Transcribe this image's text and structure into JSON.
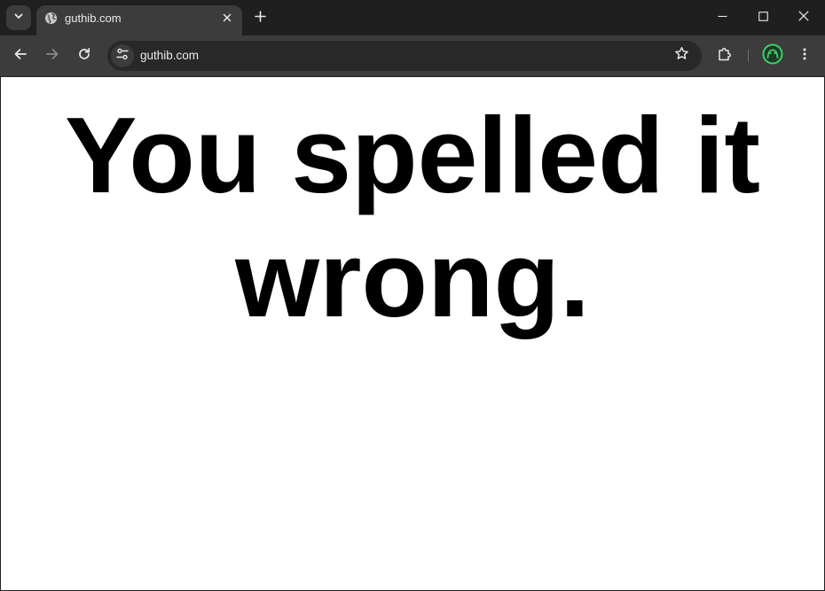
{
  "browser": {
    "tab": {
      "title": "guthib.com",
      "favicon": "globe-icon"
    },
    "address_bar": {
      "url": "guthib.com"
    },
    "colors": {
      "frame": "#1f1f1f",
      "toolbar": "#3c3c3c",
      "omnibox": "#282828",
      "profile_accent": "#3ecf6b"
    }
  },
  "page": {
    "headline": "You spelled it wrong."
  }
}
